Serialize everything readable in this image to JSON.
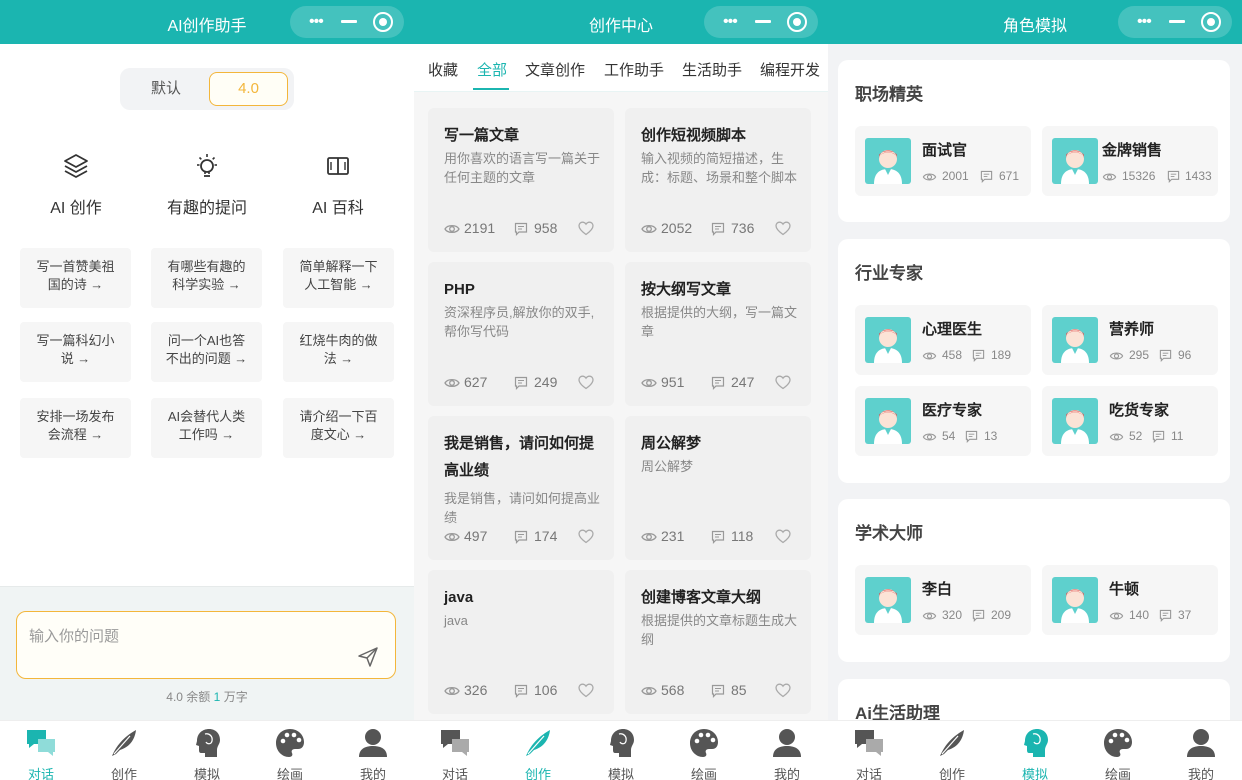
{
  "colors": {
    "accent": "#1bb5b0",
    "highlight": "#f3b63b"
  },
  "panel1": {
    "title": "AI创作助手",
    "model_toggle": {
      "default_label": "默认",
      "active_label": "4.0"
    },
    "features": [
      {
        "label": "AI 创作",
        "icon": "layers-icon"
      },
      {
        "label": "有趣的提问",
        "icon": "lightbulb-icon"
      },
      {
        "label": "AI 百科",
        "icon": "book-icon"
      }
    ],
    "suggestions": [
      "写一首赞美祖国的诗 →",
      "有哪些有趣的科学实验 →",
      "简单解释一下人工智能 →",
      "写一篇科幻小说 →",
      "问一个AI也答不出的问题 →",
      "红烧牛肉的做法 →",
      "安排一场发布会流程 →",
      "AI会替代人类工作吗 →",
      "请介绍一下百度文心 →"
    ],
    "input": {
      "placeholder": "输入你的问题"
    },
    "quota": {
      "prefix": "4.0 余额",
      "amount": "1",
      "suffix": "万字"
    }
  },
  "panel2": {
    "title": "创作中心",
    "categories": [
      "收藏",
      "全部",
      "文章创作",
      "工作助手",
      "生活助手",
      "编程开发"
    ],
    "active_category": "全部",
    "cards": [
      {
        "title": "写一篇文章",
        "desc": "用你喜欢的语言写一篇关于任何主题的文章",
        "views": "2191",
        "comments": "958"
      },
      {
        "title": "创作短视频脚本",
        "desc": "输入视频的简短描述，生成：标题、场景和整个脚本",
        "views": "2052",
        "comments": "736"
      },
      {
        "title": "PHP",
        "desc": "资深程序员,解放你的双手,帮你写代码",
        "views": "627",
        "comments": "249"
      },
      {
        "title": "按大纲写文章",
        "desc": "根据提供的大纲，写一篇文章",
        "views": "951",
        "comments": "247"
      },
      {
        "title": "我是销售，请问如何提高业绩",
        "desc": "我是销售，请问如何提高业绩",
        "views": "497",
        "comments": "174"
      },
      {
        "title": "周公解梦",
        "desc": "周公解梦",
        "views": "231",
        "comments": "118"
      },
      {
        "title": "java",
        "desc": "java",
        "views": "326",
        "comments": "106"
      },
      {
        "title": "创建博客文章大纲",
        "desc": "根据提供的文章标题生成大纲",
        "views": "568",
        "comments": "85"
      }
    ]
  },
  "panel3": {
    "title": "角色模拟",
    "sections": [
      {
        "title": "职场精英",
        "roles": [
          {
            "name": "面试官",
            "views": "2001",
            "comments": "671"
          },
          {
            "name": "金牌销售",
            "views": "15326",
            "comments": "1433"
          }
        ]
      },
      {
        "title": "行业专家",
        "roles": [
          {
            "name": "心理医生",
            "views": "458",
            "comments": "189"
          },
          {
            "name": "营养师",
            "views": "295",
            "comments": "96"
          },
          {
            "name": "医疗专家",
            "views": "54",
            "comments": "13"
          },
          {
            "name": "吃货专家",
            "views": "52",
            "comments": "11"
          }
        ]
      },
      {
        "title": "学术大师",
        "roles": [
          {
            "name": "李白",
            "views": "320",
            "comments": "209"
          },
          {
            "name": "牛顿",
            "views": "140",
            "comments": "37"
          }
        ]
      },
      {
        "title": "Ai生活助理",
        "roles": []
      }
    ]
  },
  "tabbar": {
    "tabs": [
      {
        "label": "对话",
        "icon": "chat-icon"
      },
      {
        "label": "创作",
        "icon": "feather-icon"
      },
      {
        "label": "模拟",
        "icon": "head-icon"
      },
      {
        "label": "绘画",
        "icon": "palette-icon"
      },
      {
        "label": "我的",
        "icon": "user-icon"
      }
    ]
  }
}
